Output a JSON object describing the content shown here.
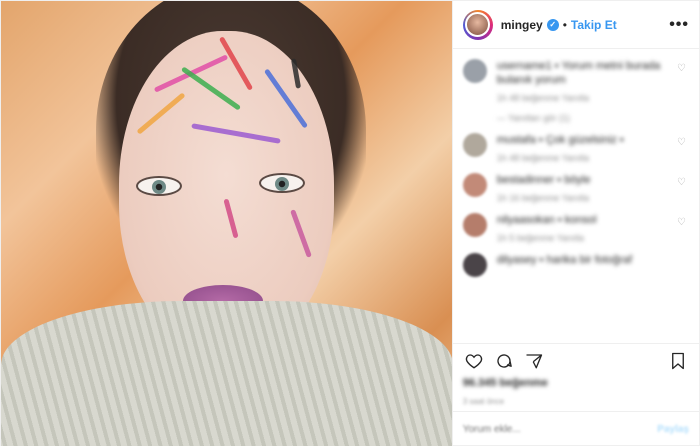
{
  "post": {
    "username": "mingey",
    "follow_label": "Takip Et",
    "separator": "•",
    "more_label": "•••"
  },
  "comments": [
    {
      "text": "username1 ▪ Yorum metni burada",
      "text2": "bulanık yorum",
      "meta": "1h  48 beğenme  Yanıtla",
      "replies": "— Yanıtları gör (1)",
      "avatar_color": "#9aa0a8"
    },
    {
      "text": "mustafa ▪ Çok güzelsiniz ▪",
      "meta": "1h  48 beğenme  Yanıtla",
      "avatar_color": "#b0a89c"
    },
    {
      "text": "bestadinner ▪ böyle",
      "meta": "1h  16 beğenme  Yanıtla",
      "avatar_color": "#c28a78"
    },
    {
      "text": "nilyaasokan ▪ konsol",
      "meta": "1h  5 beğenme  Yanıtla",
      "avatar_color": "#b57d6b"
    },
    {
      "text": "dilyasey ▪ harika bir fotoğraf",
      "meta": "",
      "avatar_color": "#4a4448"
    }
  ],
  "likes": "96.345 beğenme",
  "date": "3 saat önce",
  "add_comment": {
    "placeholder": "Yorum ekle...",
    "post_label": "Paylaş"
  },
  "icons": {
    "like": "heart-icon",
    "comment": "comment-icon",
    "share": "share-icon",
    "save": "bookmark-icon"
  },
  "colors": {
    "accent": "#3897f0",
    "text": "#262626",
    "muted": "#8e8e8e"
  }
}
